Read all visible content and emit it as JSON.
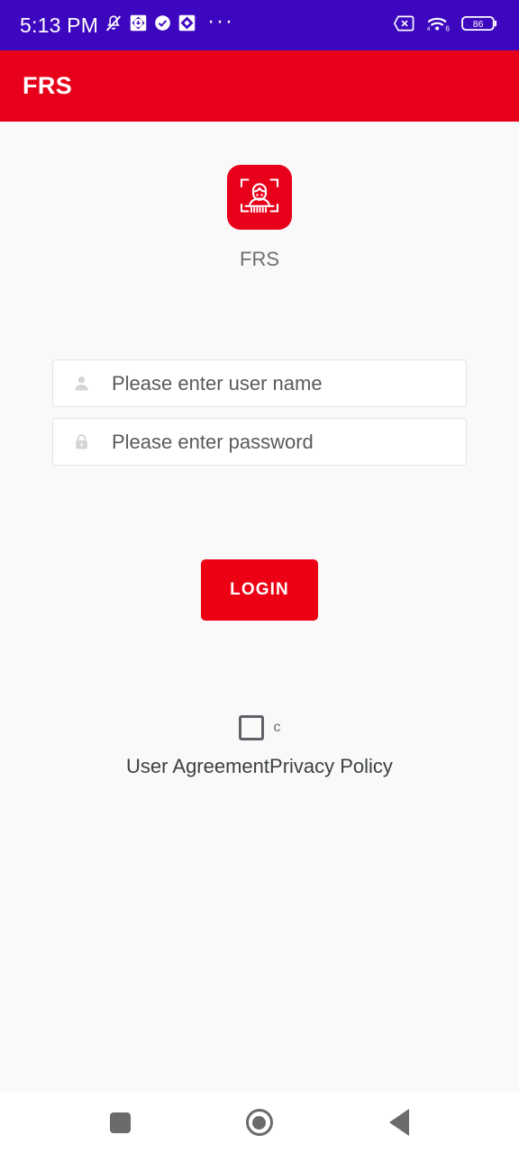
{
  "status_bar": {
    "time": "5:13 PM",
    "background_color": "#3d07bf",
    "overflow_dots": "···",
    "left_icons": [
      "bell-mute-icon",
      "app-badge-diamond-icon",
      "check-circle-icon",
      "app-badge-diamond-icon"
    ],
    "right_icons": [
      "no-sim-icon",
      "wifi-6-icon",
      "battery-icon"
    ],
    "battery_level": "86"
  },
  "app_bar": {
    "title": "FRS",
    "background_color": "#e8001a",
    "title_color": "#ffffff"
  },
  "logo": {
    "icon_name": "face-recognition-icon",
    "label": "FRS",
    "background_color": "#e8001a"
  },
  "form": {
    "username": {
      "icon_name": "user-icon",
      "placeholder": "Please enter user name",
      "value": ""
    },
    "password": {
      "icon_name": "lock-icon",
      "placeholder": "Please enter password",
      "value": ""
    }
  },
  "login_button": {
    "label": "LOGIN",
    "background_color": "#eb0014",
    "text_color": "#ffffff"
  },
  "agreement": {
    "checkbox_checked": false,
    "checkbox_label": "c",
    "links": [
      {
        "label": "User Agreement"
      },
      {
        "label": "Privacy Policy"
      }
    ]
  },
  "nav_bar": {
    "buttons": [
      {
        "name": "recents",
        "icon_name": "square-icon"
      },
      {
        "name": "home",
        "icon_name": "circle-icon"
      },
      {
        "name": "back",
        "icon_name": "triangle-left-icon"
      }
    ]
  }
}
